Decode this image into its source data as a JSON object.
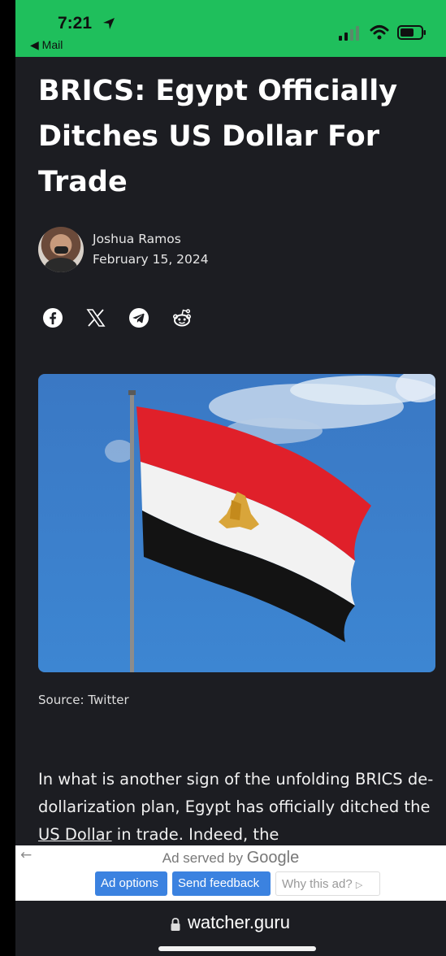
{
  "status_bar": {
    "time": "7:21",
    "back_app": "◀ Mail",
    "background": "#1fbf5c"
  },
  "article": {
    "title": "BRICS: Egypt Officially Ditches US Dollar For Trade",
    "author": "Joshua Ramos",
    "date": "February 15, 2024",
    "share_icons": [
      "facebook-icon",
      "x-icon",
      "telegram-icon",
      "reddit-icon"
    ],
    "image_caption": "Source: Twitter",
    "body_parts": [
      "In what is another sign of the unfolding BRICS de-dollarization plan, Egypt has officially ditched the ",
      "US Dollar",
      " in trade. Indeed, the"
    ]
  },
  "ad_bar": {
    "served_by": "Ad served by",
    "google": "Google",
    "buttons": [
      "Ad options",
      "Send feedback",
      "Why this ad?"
    ],
    "accent": "#3b82e0"
  },
  "browser": {
    "url": "watcher.guru"
  }
}
